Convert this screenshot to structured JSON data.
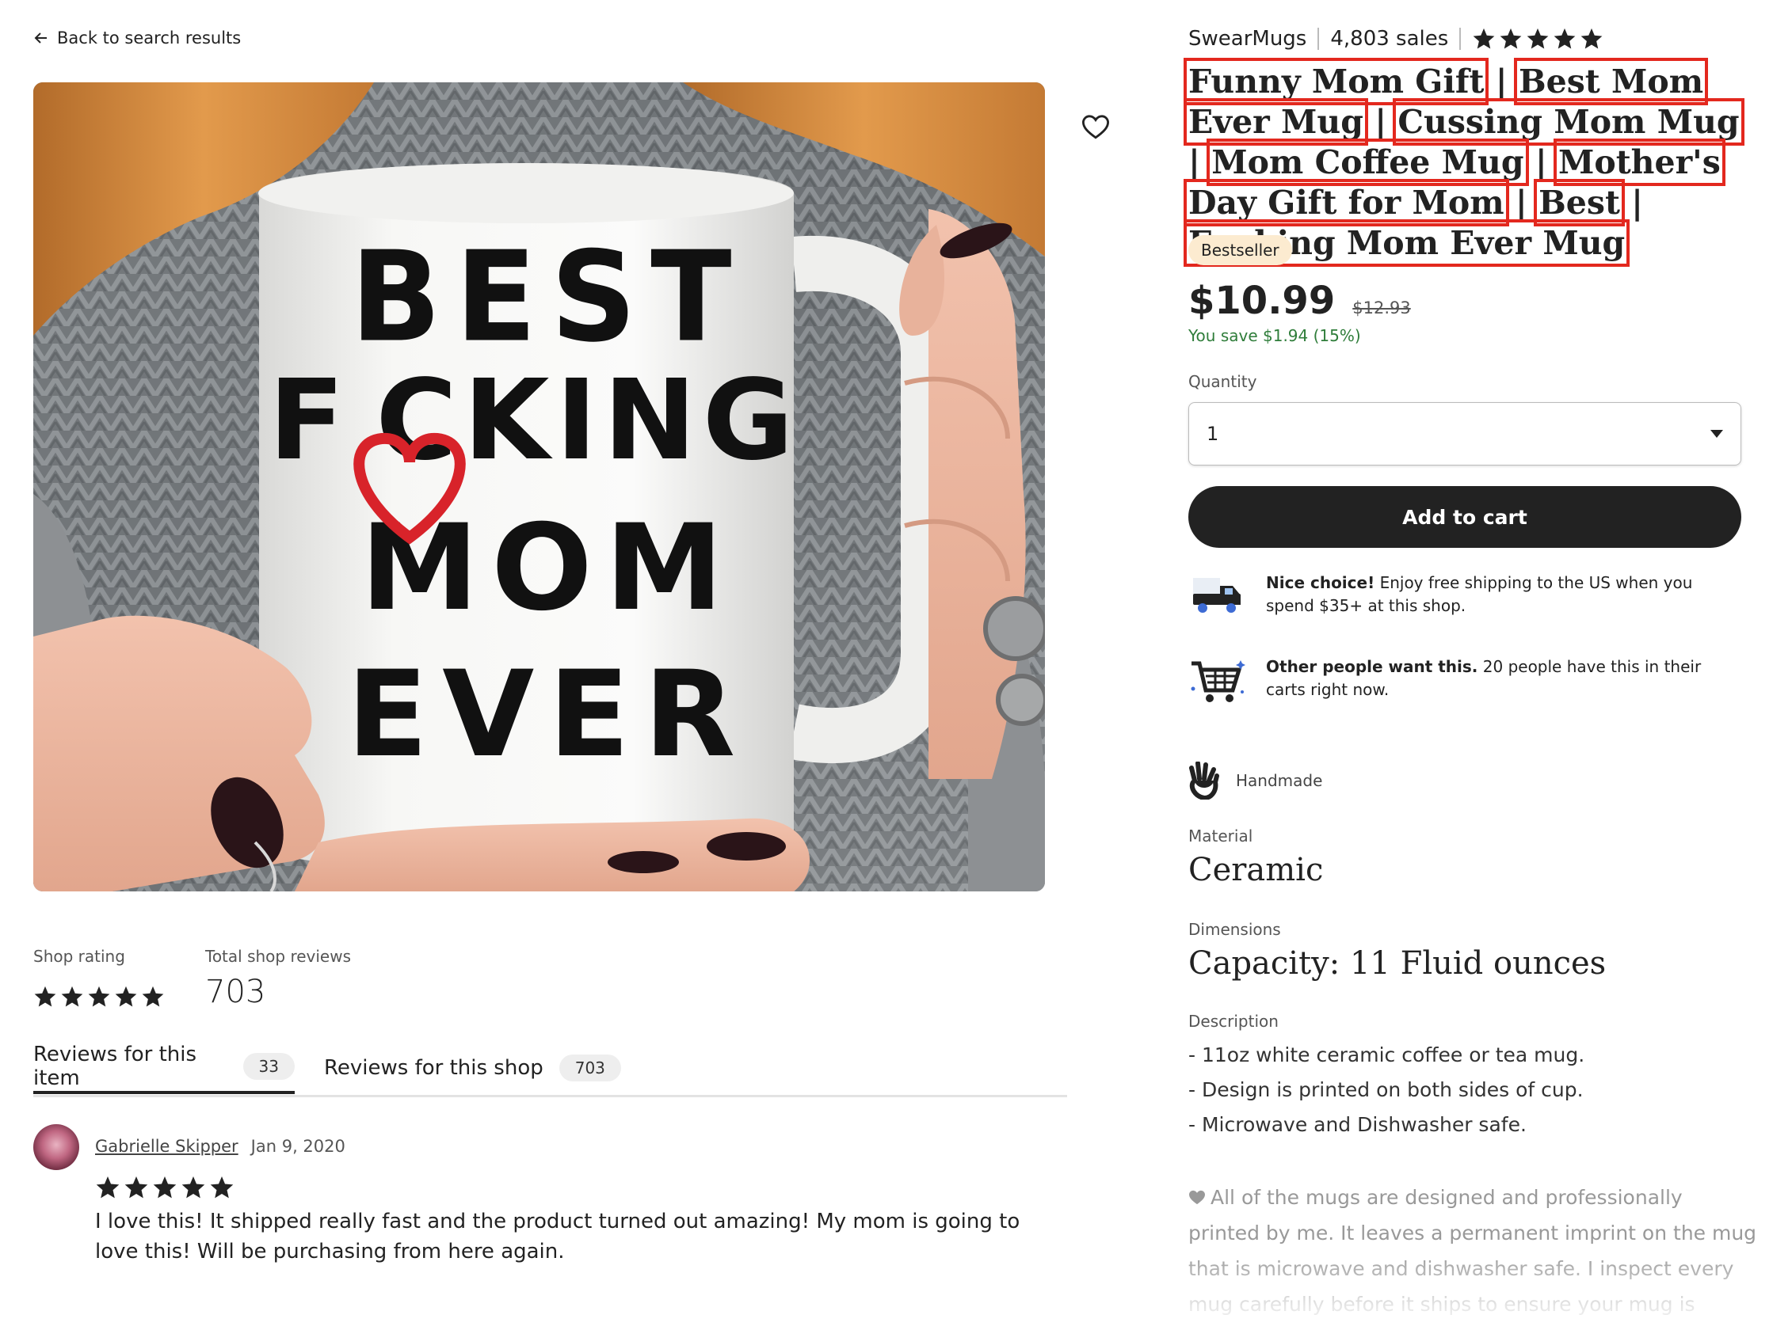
{
  "nav": {
    "back_label": "Back to search results"
  },
  "product_image": {
    "lines": [
      "BEST",
      "F",
      "CKING",
      "MOM",
      "EVER"
    ],
    "heart_color": "#d8232a"
  },
  "shop_stats": {
    "rating_label": "Shop rating",
    "rating_value": 5,
    "reviews_label": "Total shop reviews",
    "reviews_count": "703"
  },
  "review_tabs": [
    {
      "label": "Reviews for this item",
      "count": "33",
      "active": true
    },
    {
      "label": "Reviews for this shop",
      "count": "703",
      "active": false
    }
  ],
  "review": {
    "author": "Gabrielle Skipper",
    "date": "Jan 9, 2020",
    "rating": 5,
    "text": "I love this! It shipped really fast and the product turned out amazing! My mom is going to love this! Will be purchasing from here again."
  },
  "listing": {
    "shop_name": "SwearMugs",
    "sales": "4,803 sales",
    "shop_rating": 5,
    "title_parts": [
      {
        "text": "Funny Mom Gift"
      },
      {
        "text": "Best Mom Ever Mug"
      },
      {
        "text": "Cussing Mom Mug"
      },
      {
        "text": "Mom Coffee Mug"
      },
      {
        "text": "Mother's Day Gift for Mom"
      },
      {
        "text": "Best"
      },
      {
        "text": "Fucking Mom Ever Mug"
      }
    ],
    "title_separator": "|",
    "badge": "Bestseller",
    "price": "$10.99",
    "original_price": "$12.93",
    "savings": "You save $1.94 (15%)",
    "quantity_label": "Quantity",
    "quantity_value": "1",
    "add_to_cart": "Add to cart",
    "notes": [
      {
        "icon": "delivery-truck-icon",
        "bold": "Nice choice!",
        "text": " Enjoy free shipping to the US when you spend $35+ at this shop."
      },
      {
        "icon": "shopping-cart-icon",
        "bold": "Other people want this.",
        "text": " 20 people have this in their carts right now."
      }
    ],
    "handmade": "Handmade",
    "material_label": "Material",
    "material_value": "Ceramic",
    "dimensions_label": "Dimensions",
    "dimensions_value": "Capacity: 11 Fluid ounces",
    "description_label": "Description",
    "description_lines": [
      "- 11oz white ceramic coffee or tea mug.",
      "- Design is printed on both sides of cup.",
      "- Microwave and Dishwasher safe."
    ],
    "description_more": "All of the mugs are designed and professionally printed by me. It leaves a permanent imprint on the mug that is microwave and dishwasher safe. I inspect every mug carefully before it ships to ensure your mug is"
  },
  "colors": {
    "highlight_box": "#e3281e",
    "bestseller_bg": "#fcebd0",
    "savings_green": "#2f7d3a",
    "button_dark": "#222222"
  }
}
